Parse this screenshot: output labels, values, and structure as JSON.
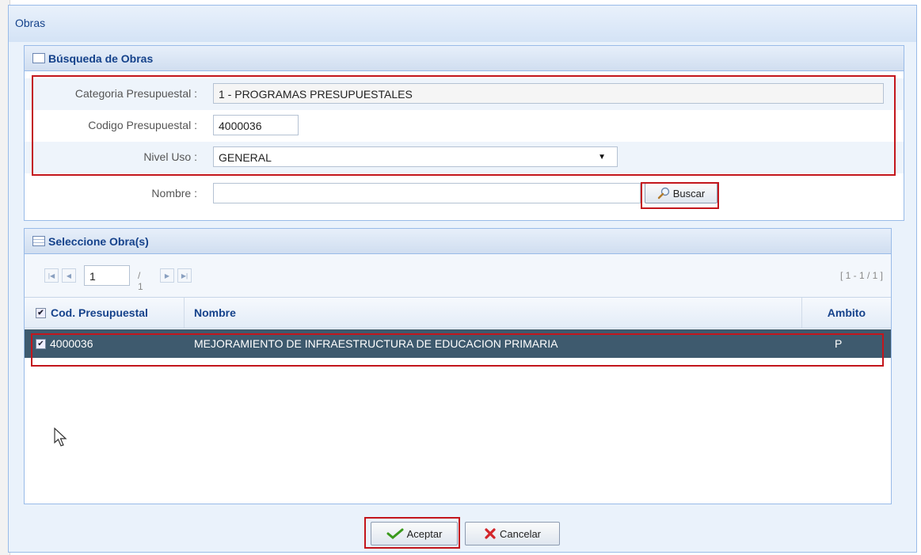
{
  "dialog": {
    "title": "Obras"
  },
  "search": {
    "title": "Búsqueda de Obras",
    "categoria_label": "Categoria Presupuestal :",
    "categoria_value": "1 - PROGRAMAS PRESUPUESTALES",
    "codigo_label": "Codigo Presupuestal :",
    "codigo_value": "4000036",
    "nivel_label": "Nivel Uso :",
    "nivel_value": "GENERAL",
    "nombre_label": "Nombre :",
    "nombre_value": "",
    "buscar_label": "Buscar"
  },
  "grid": {
    "title": "Seleccione Obra(s)",
    "pager": {
      "page": "1",
      "of_total": "/ 1",
      "range": "[ 1 - 1 / 1 ]"
    },
    "columns": [
      "Cod. Presupuestal",
      "Nombre",
      "Ambito"
    ],
    "rows": [
      {
        "cod": "4000036",
        "nombre": "MEJORAMIENTO DE INFRAESTRUCTURA DE EDUCACION PRIMARIA",
        "ambito": "P",
        "checked": true
      }
    ]
  },
  "footer": {
    "accept_label": "Aceptar",
    "cancel_label": "Cancelar"
  },
  "colors": {
    "accent": "#15428b",
    "selected_row": "#3e5a6e",
    "highlight": "#c3161c"
  }
}
